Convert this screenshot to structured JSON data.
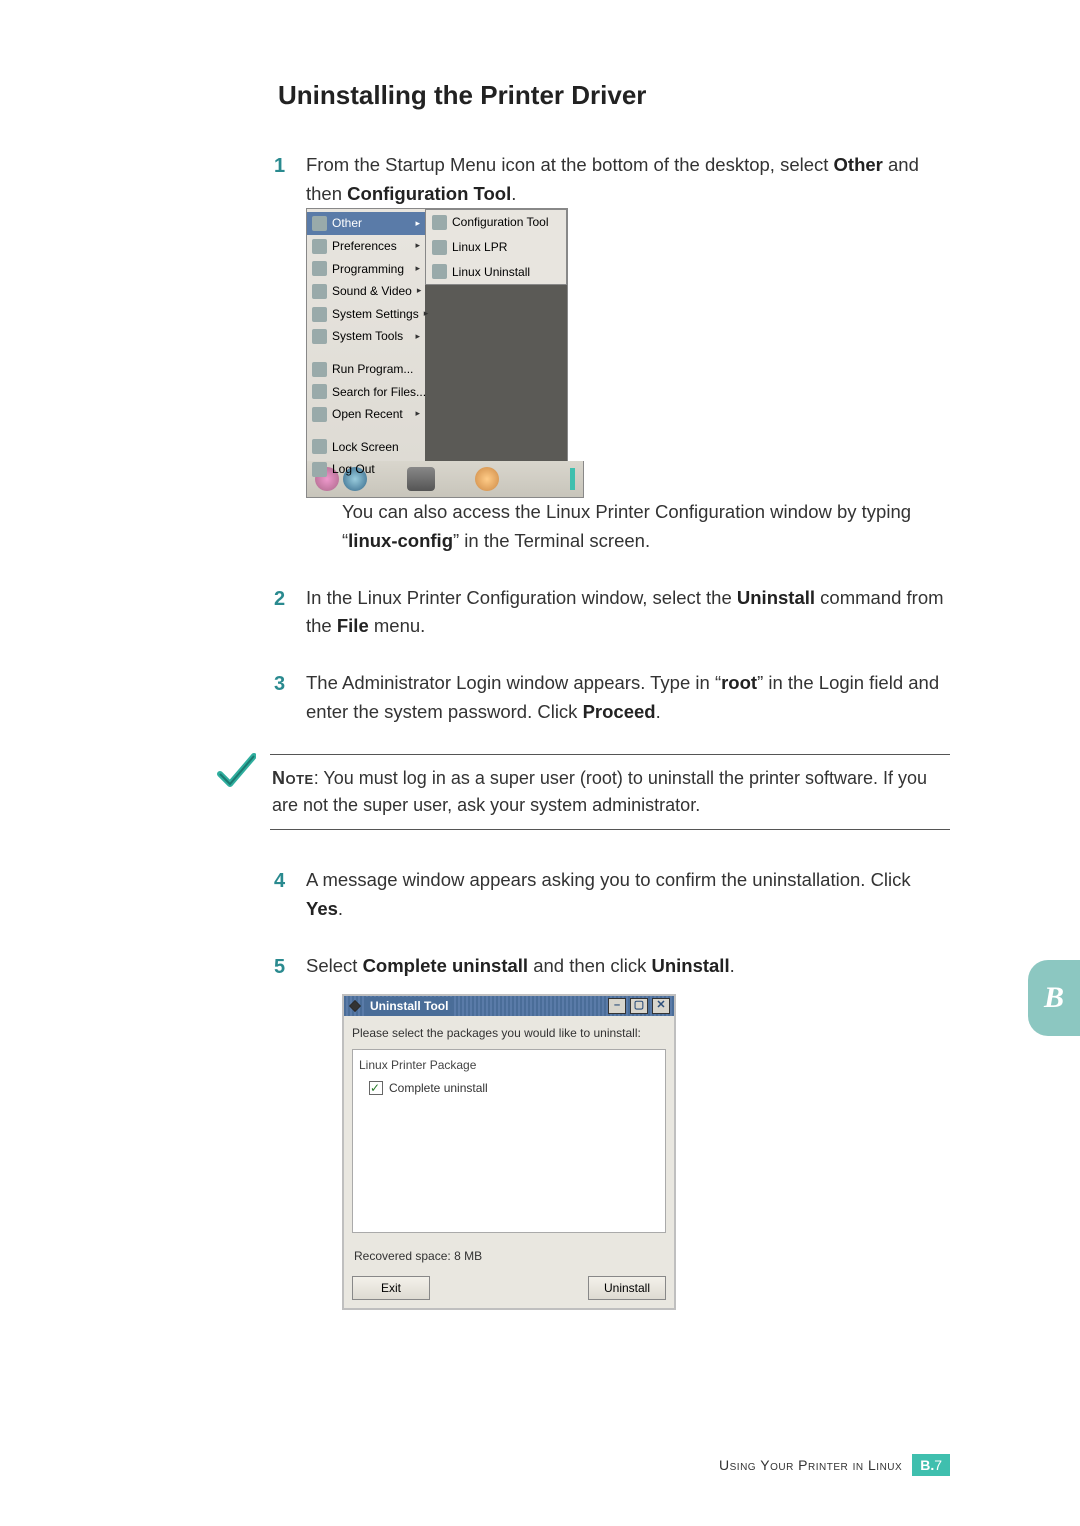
{
  "title": "Uninstalling the Printer Driver",
  "steps": {
    "s1": {
      "num": "1",
      "pre": "From the Startup Menu icon at the bottom of the desktop, select ",
      "b1": "Other",
      "mid": " and then ",
      "b2": "Configuration Tool",
      "post": "."
    },
    "s1_after": {
      "pre": "You can also access the Linux Printer Configuration window by typing “",
      "b1": "linux-config",
      "post": "” in the Terminal screen."
    },
    "s2": {
      "num": "2",
      "pre": "In the Linux Printer Configuration window, select the ",
      "b1": "Uninstall",
      "mid": " command from the ",
      "b2": "File",
      "post": " menu."
    },
    "s3": {
      "num": "3",
      "pre": "The Administrator Login window appears. Type in “",
      "b1": "root",
      "mid": "” in the Login field and enter the system password. Click ",
      "b2": "Proceed",
      "post": "."
    },
    "s4": {
      "num": "4",
      "pre": "A message window appears asking you to confirm the uninstallation. Click ",
      "b1": "Yes",
      "post": "."
    },
    "s5": {
      "num": "5",
      "pre": "Select ",
      "b1": "Complete uninstall",
      "mid": " and then click ",
      "b2": "Uninstall",
      "post": "."
    }
  },
  "note": {
    "label": "Note",
    "text": ": You must log in as a super user (root) to uninstall the printer software. If you are not the super user, ask your system administrator."
  },
  "shot1": {
    "menu": [
      "Other",
      "Preferences",
      "Programming",
      "Sound & Video",
      "System Settings",
      "System Tools"
    ],
    "menu2": [
      "Run Program...",
      "Search for Files...",
      "Open Recent"
    ],
    "menu3": [
      "Lock Screen",
      "Log Out"
    ],
    "submenu": [
      "Configuration Tool",
      "Linux LPR",
      "Linux Uninstall"
    ]
  },
  "shot2": {
    "title": "Uninstall Tool",
    "instruction": "Please select the packages you would like to uninstall:",
    "group": "Linux Printer Package",
    "option": "Complete uninstall",
    "recovered_label": "Recovered space:  ",
    "recovered_value": "8 MB",
    "exit": "Exit",
    "uninstall": "Uninstall"
  },
  "side_tab": "B",
  "footer": {
    "text": "Using Your Printer in Linux",
    "page_prefix": "B.",
    "page_num": "7"
  }
}
